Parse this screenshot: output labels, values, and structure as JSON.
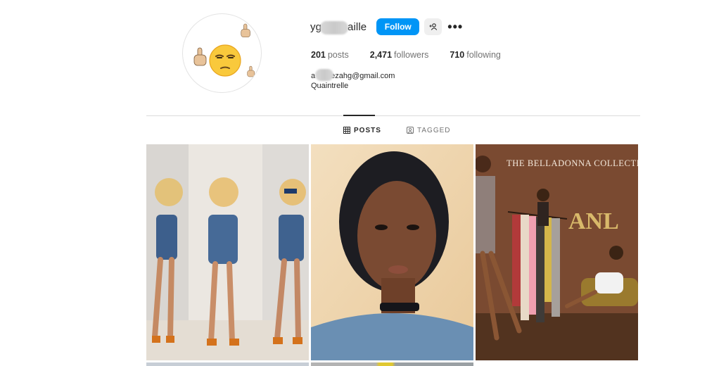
{
  "profile": {
    "username_prefix": "yg",
    "username_suffix": "aille",
    "follow_label": "Follow",
    "more_label": "•••",
    "stats": {
      "posts_count": "201",
      "posts_label": "posts",
      "followers_count": "2,471",
      "followers_label": "followers",
      "following_count": "710",
      "following_label": "following"
    },
    "bio": {
      "email_prefix": "a",
      "email_suffix": "ezahg@gmail.com",
      "name": "Quaintrelle"
    },
    "avatar_icons": [
      "unamused-face-emoji",
      "middle-finger-emoji"
    ]
  },
  "tabs": [
    {
      "label": "POSTS",
      "icon": "grid-icon",
      "active": true
    },
    {
      "label": "TAGGED",
      "icon": "tagged-icon",
      "active": false
    }
  ],
  "posts": [
    {
      "caption": ""
    },
    {
      "caption": ""
    },
    {
      "caption": "THE BELLADONNA COLLECTION",
      "logo_text": "ANL"
    }
  ],
  "colors": {
    "accent": "#0095f6",
    "text": "#262626",
    "secondary_text": "#737373",
    "divider": "#dbdbdb"
  }
}
